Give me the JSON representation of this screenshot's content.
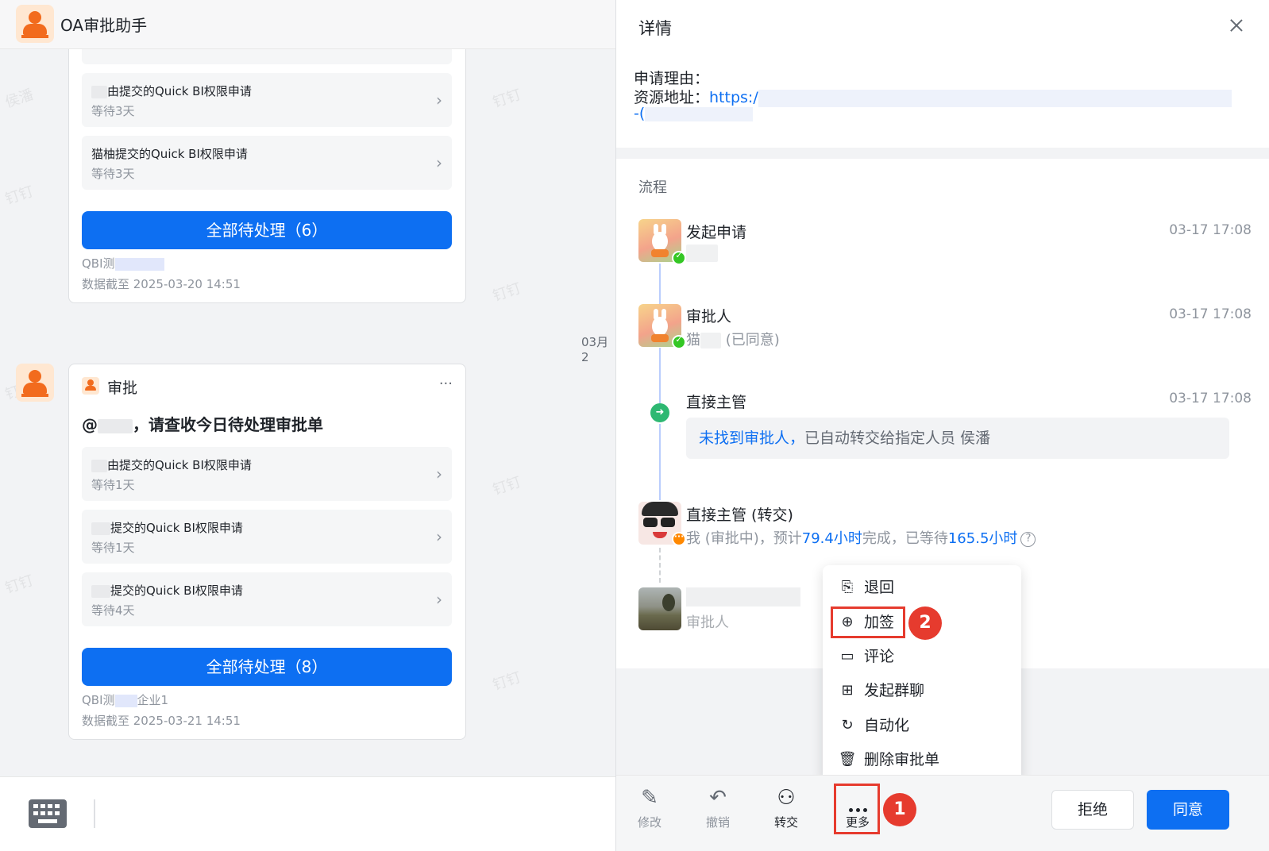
{
  "chat": {
    "title": "OA审批助手",
    "card1": {
      "items": [
        {
          "title": "由提交的Quick BI权限申请",
          "wait": "等待3天"
        },
        {
          "title": "猫柚提交的Quick BI权限申请",
          "wait": "等待3天"
        }
      ],
      "button": "全部待处理（6）",
      "source": "QBI测",
      "data_time": "数据截至 2025-03-20 14:51"
    },
    "timestamp": "03月2",
    "card2": {
      "label": "审批",
      "more": "···",
      "heading_prefix": "@",
      "heading_suffix": "，请查收今日待处理审批单",
      "items": [
        {
          "title": "由提交的Quick BI权限申请",
          "wait": "等待1天"
        },
        {
          "title": "提交的Quick BI权限申请",
          "wait": "等待1天"
        },
        {
          "title": "提交的Quick BI权限申请",
          "wait": "等待4天"
        }
      ],
      "button": "全部待处理（8）",
      "source": "QBI测",
      "source_suffix": "企业1",
      "data_time": "数据截至 2025-03-21 14:51"
    },
    "watermarks": [
      "侯潘",
      "钉钉",
      "钉钉",
      "钉钉",
      "钉钉",
      "钉钉",
      "钉钉",
      "钉钉"
    ]
  },
  "detail": {
    "title": "详情",
    "reason_label": "申请理由：",
    "resource_label": "资源地址：",
    "resource_link": "https:/",
    "resource_cont": "-(",
    "flow_label": "流程",
    "nodes": [
      {
        "title": "发起申请",
        "time": "03-17 17:08"
      },
      {
        "title": "审批人",
        "time": "03-17 17:08",
        "sub_prefix": "猫",
        "sub_status": "(已同意)"
      },
      {
        "title": "直接主管",
        "time": "03-17 17:08",
        "auto_hl": "未找到审批人，",
        "auto_text": "已自动转交给指定人员 侯潘"
      },
      {
        "title": "直接主管 (转交)",
        "sub_a": "我 (审批中)，预计",
        "sub_b": "79.4小时",
        "sub_c": "完成，已等待",
        "sub_d": "165.5小时",
        "help": "?"
      },
      {
        "sub": "审批人"
      }
    ],
    "menu": {
      "items": [
        {
          "icon": "file-return-icon",
          "label": "退回"
        },
        {
          "icon": "file-add-icon",
          "label": "加签"
        },
        {
          "icon": "comment-icon",
          "label": "评论"
        },
        {
          "icon": "group-chat-icon",
          "label": "发起群聊"
        },
        {
          "icon": "automation-icon",
          "label": "自动化"
        },
        {
          "icon": "trash-icon",
          "label": "删除审批单"
        }
      ]
    },
    "actions": {
      "edit": "修改",
      "revoke": "撤销",
      "transfer": "转交",
      "more": "更多",
      "reject": "拒绝",
      "approve": "同意"
    },
    "badges": {
      "one": "1",
      "two": "2"
    }
  },
  "colors": {
    "primary": "#0d6ff2",
    "highlight": "#e63b2e",
    "bot": "#f26b1d"
  }
}
